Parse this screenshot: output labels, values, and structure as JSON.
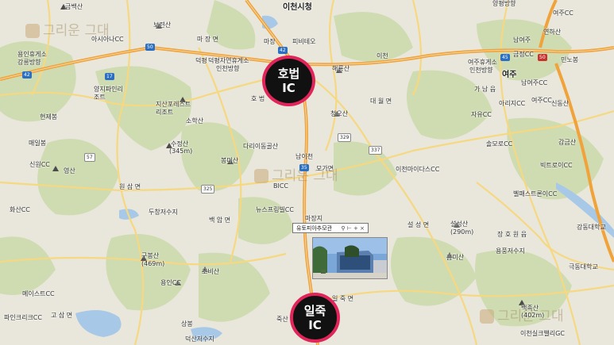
{
  "map_title": "",
  "badges": {
    "hobeop": {
      "line1": "호법",
      "line2": "IC"
    },
    "iljuk": {
      "line1": "일죽",
      "line2": "IC"
    }
  },
  "popup": {
    "title": "유토피아추모관",
    "controls": "⚲ ⊢ + ×"
  },
  "watermark": "그리운 그대",
  "labels": {
    "icheon_city": "이천시청",
    "geumbaeksan": "금백산",
    "yangpyeong": "양평방향",
    "yeoju_cc": "여주CC",
    "boreonsan": "보련산",
    "asiana_cc": "아시아나CC",
    "machangsan": "마 장 면",
    "majang": "마장",
    "pitoreo": "피비테오",
    "namyeoju": "남여주",
    "yeonhasan": "연하산",
    "yongin_rest": "용인휴게소",
    "gangneung1": "강릉방향",
    "deokpyeong": "덕평",
    "deokpyeong_rest": "덕평자연휴게소",
    "incheon1": "인천방향",
    "icheon_ic": "이천",
    "yeoju_rest": "여주휴게소",
    "incheon2": "인천방향",
    "geumjeongcc": "금정CC",
    "minnoksan": "민노봉",
    "haeryongsan": "해룡산",
    "yeoju": "여주",
    "gaeamsan": "가 남 읍",
    "namyeoju_cc": "남여주CC",
    "yangji_pine": "양지파인리조트",
    "jisan_forest": "지산포레스트리조트",
    "hobeop_myeon": "호 법",
    "jaguksan": "자유CC",
    "arirang": "아리지CC",
    "yeoju_cc2": "여주CC",
    "sinbongsan": "신동산",
    "hyeonjaebong": "현제봉",
    "sohaksan": "소학산",
    "cheongosan": "청오산",
    "daewolmyeon": "대 월 면",
    "maeilbong": "매일봉",
    "sujeongsan": "수정산",
    "sujeong_h": "(345m)",
    "dari_cc": "다리이동골산",
    "solmoro": "솔모로CC",
    "ganggeumsan": "감금산",
    "sinwon_cc": "신원CC",
    "yeongsan": "영산",
    "bonghwasan": "봉미산",
    "namicheon": "남이천",
    "moga": "모가면",
    "icheon_midas": "이천마이다스CC",
    "vixtro": "빅트로이CC",
    "wonsam": "원 삼 면",
    "bicc": "BICC",
    "belleforet": "벨패스트론이CC",
    "hwasan_cc": "화산CC",
    "newsprings": "뉴스프링빌CC",
    "dupyo": "두창저수지",
    "baekam": "백 암 면",
    "majang_cc": "마장지",
    "seolseong": "설 성 면",
    "seolseongsan": "설성산",
    "seolseong_h": "(290m)",
    "gangdong_univ": "강동대학교",
    "jangho": "장 호 원 읍",
    "yongpung": "용풍저수지",
    "gubongsan": "구봉산",
    "gubong_h": "(469m)",
    "heumisan": "흠미산",
    "guktong": "극동대학교",
    "yongin_cc": "용인CC",
    "jobisan": "조비산",
    "maeseu_cc": "메이스트CC",
    "iljuk_myeon": "일 죽 면",
    "baekjoksan": "백족산",
    "baekjok_h": "(402m)",
    "gosam": "고 삼 면",
    "pine_cc": "파인크리크CC",
    "sangbong": "상봉",
    "deoksan": "덕산저수지",
    "icheon_yulbel": "이천실크밸리GC",
    "jukjan": "죽산"
  },
  "shields": {
    "r50a": "50",
    "r42a": "42",
    "r17": "17",
    "r50b": "50",
    "r45": "45",
    "r42b": "42",
    "r325": "325",
    "r329": "329",
    "r337": "337",
    "r35": "35",
    "r57": "57"
  },
  "colors": {
    "badge_bg": "#111111",
    "badge_ring": "#e1245a",
    "highway": "#f4a340",
    "road": "#f7d77a",
    "forest": "#c9d8a8",
    "land": "#e9e7dc",
    "water": "#9fc3e8"
  }
}
